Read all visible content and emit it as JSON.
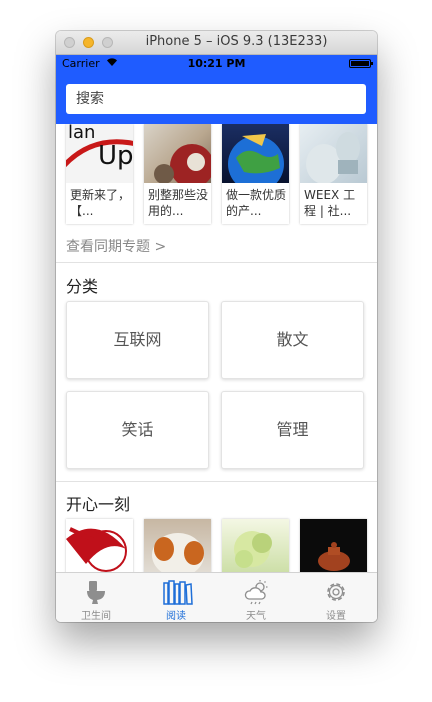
{
  "window": {
    "title": "iPhone 5 – iOS 9.3 (13E233)"
  },
  "status_bar": {
    "carrier": "Carrier",
    "time": "10:21 PM"
  },
  "search": {
    "placeholder": "搜索"
  },
  "featured": {
    "cards": [
      {
        "caption": "更新来了，【..."
      },
      {
        "caption": "别整那些没用的..."
      },
      {
        "caption": "做一款优质的产..."
      },
      {
        "caption": "WEEX 工程 | 社..."
      }
    ],
    "see_all": "查看同期专题 >"
  },
  "categories": {
    "title": "分类",
    "items": [
      "互联网",
      "散文",
      "笑话",
      "管理"
    ]
  },
  "happy_moment": {
    "title": "开心一刻"
  },
  "tabs": [
    {
      "label": "卫生间",
      "icon": "toilet-icon",
      "active": false
    },
    {
      "label": "阅读",
      "icon": "books-icon",
      "active": true
    },
    {
      "label": "天气",
      "icon": "weather-icon",
      "active": false
    },
    {
      "label": "设置",
      "icon": "gear-icon",
      "active": false
    }
  ],
  "colors": {
    "brand_blue": "#1f5cff",
    "active_tab": "#1f6fd8",
    "inactive_tab": "#8e8e8e"
  }
}
